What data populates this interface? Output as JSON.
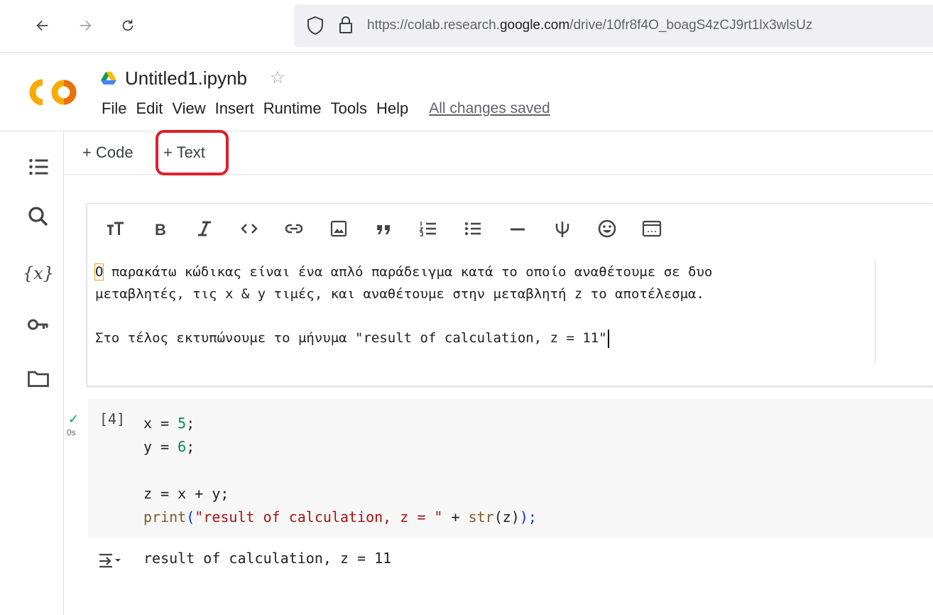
{
  "browser": {
    "url_prefix": "https://colab.research.",
    "url_domain": "google.com",
    "url_suffix": "/drive/10fr8f4O_boagS4zCJ9rt1lx3wlsUz"
  },
  "notebook": {
    "title": "Untitled1.ipynb",
    "save_status": "All changes saved",
    "menu": [
      "File",
      "Edit",
      "View",
      "Insert",
      "Runtime",
      "Tools",
      "Help"
    ]
  },
  "toolbar": {
    "add_code": "+ Code",
    "add_text": "+ Text"
  },
  "text_cell": {
    "lines": [
      "Ο παρακάτω κώδικας είναι ένα απλό παράδειγμα κατά το οποίο αναθέτουμε σε δυο",
      "μεταβλητές, τις x & y τιμές, και αναθέτουμε στην μεταβλητή z το αποτέλεσμα.",
      "",
      "Στο τέλος εκτυπώνουμε το μήνυμα \"result of calculation, z = 11\""
    ],
    "first_char": "Ο",
    "line1_rest": " παρακάτω κώδικας είναι ένα απλό παράδειγμα κατά το οποίο αναθέτουμε σε δυο",
    "line2": "μεταβλητές, τις x & y τιμές, και αναθέτουμε στην μεταβλητή z το αποτέλεσμα.",
    "line4": "Στο τέλος εκτυπώνουμε το μήνυμα \"result of calculation, z = 11\""
  },
  "code_cell": {
    "exec_count": "[4]",
    "run_time": "0s",
    "lines": [
      "x = 5;",
      "y = 6;",
      "",
      "z = x + y;",
      "print(\"result of calculation, z = \" + str(z));"
    ],
    "output": "result of calculation, z = 11"
  },
  "tokens": {
    "x_eq": "x = ",
    "five": "5",
    "y_eq": "y = ",
    "six": "6",
    "semi": ";",
    "z_line": "z = x + y;",
    "print": "print",
    "lparen": "(",
    "str_lit": "\"result of calculation, z = \"",
    "plus": " + ",
    "str_fn": "str",
    "z_arg": "(z)",
    "rparen_semi": ");"
  },
  "colors": {
    "highlight": "#e01e2b",
    "colab_orange": "#f9ab00",
    "check_green": "#0f9d58"
  }
}
